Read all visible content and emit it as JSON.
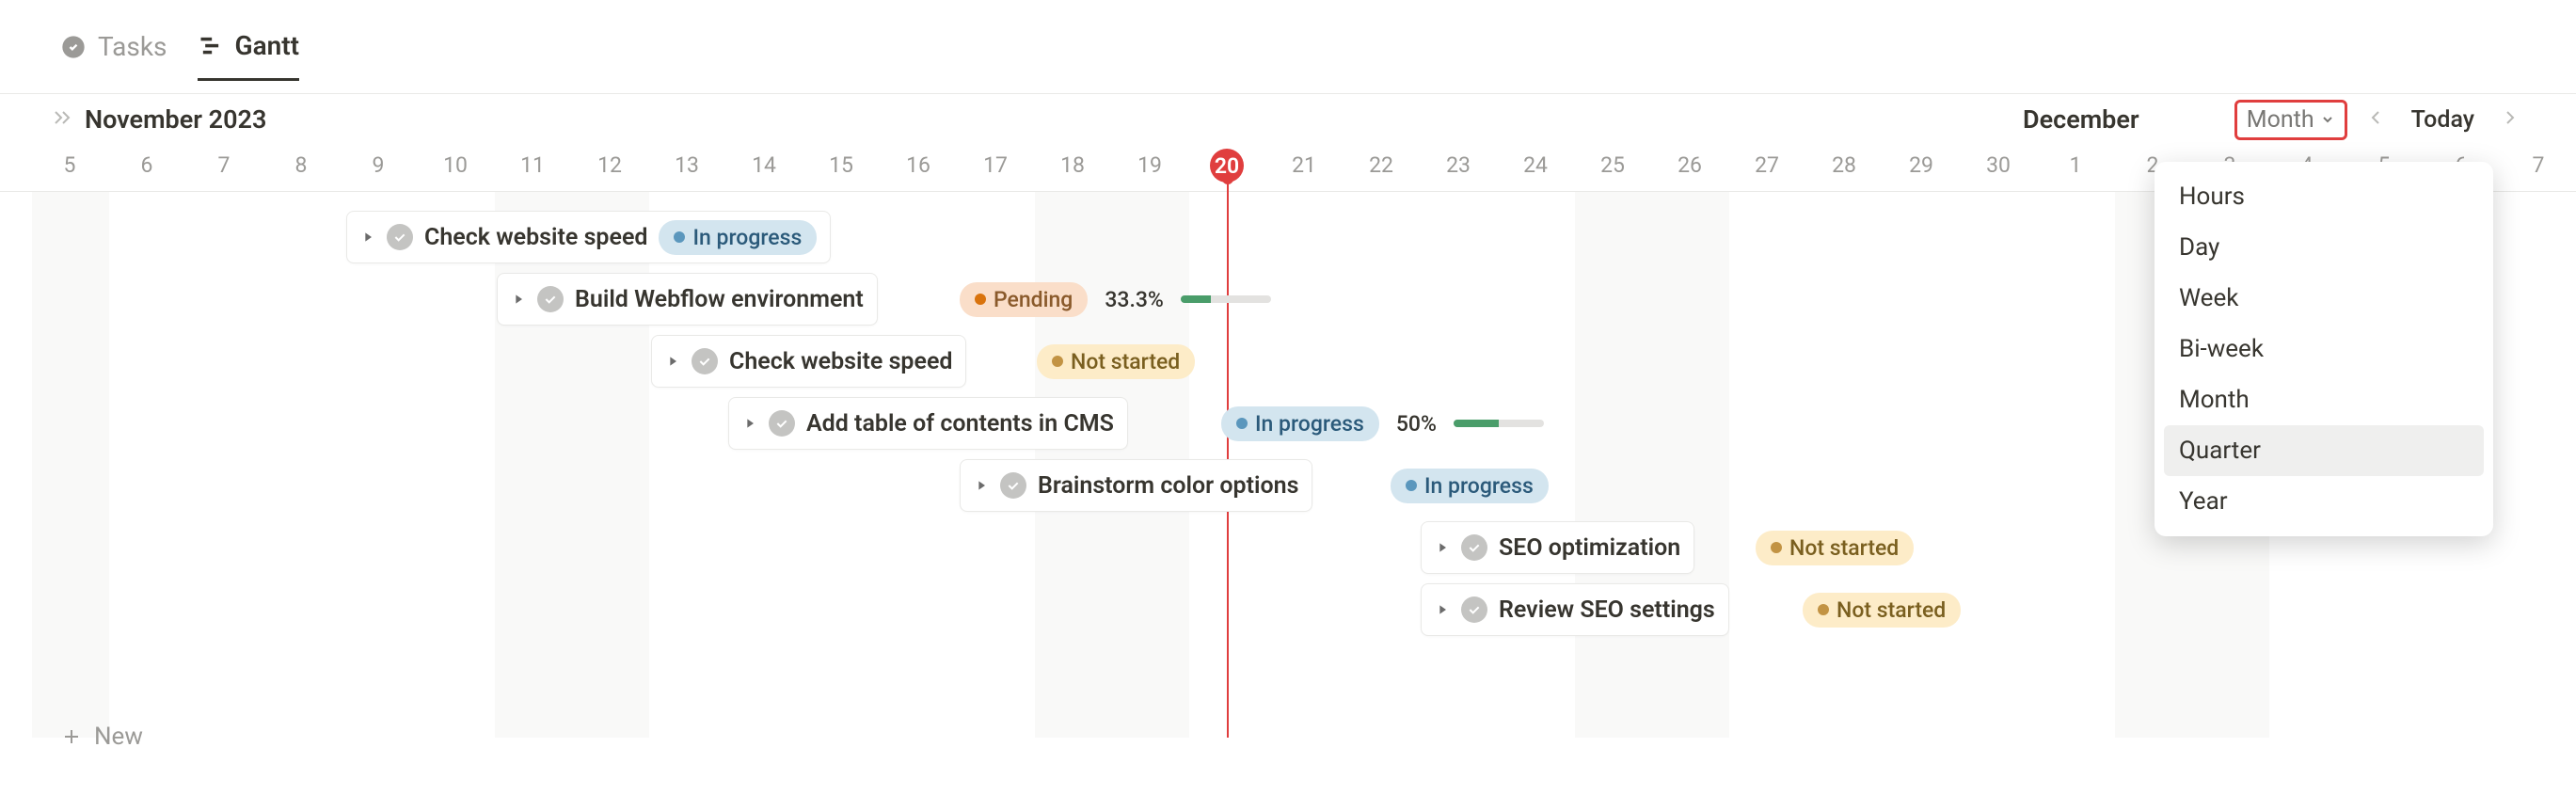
{
  "tabs": {
    "tasks_label": "Tasks",
    "gantt_label": "Gantt"
  },
  "header": {
    "month_primary": "November 2023",
    "month_secondary": "December",
    "zoom_label": "Month",
    "today_label": "Today"
  },
  "dates": [
    "5",
    "6",
    "7",
    "8",
    "9",
    "10",
    "11",
    "12",
    "13",
    "14",
    "15",
    "16",
    "17",
    "18",
    "19",
    "20",
    "21",
    "22",
    "23",
    "24",
    "25",
    "26",
    "27",
    "28",
    "29",
    "30",
    "1",
    "2",
    "3",
    "4",
    "5",
    "6",
    "7"
  ],
  "today_index": 15,
  "zoom_options": [
    "Hours",
    "Day",
    "Week",
    "Bi-week",
    "Month",
    "Quarter",
    "Year"
  ],
  "zoom_hover_index": 5,
  "tasks": [
    {
      "title": "Check website speed",
      "status_label": "In progress",
      "status_color": "blue"
    },
    {
      "title": "Build Webflow environment",
      "status_label": "Pending",
      "status_color": "orange",
      "percent": "33.3%",
      "progress": 33
    },
    {
      "title": "Check website speed",
      "status_label": "Not started",
      "status_color": "yellow"
    },
    {
      "title": "Add table of contents in CMS",
      "status_label": "In progress",
      "status_color": "blue",
      "percent": "50%",
      "progress": 50
    },
    {
      "title": "Brainstorm color options",
      "status_label": "In progress",
      "status_color": "blue"
    },
    {
      "title": "SEO optimization",
      "status_label": "Not started",
      "status_color": "yellow"
    },
    {
      "title": "Review SEO settings",
      "status_label": "Not started",
      "status_color": "yellow"
    }
  ],
  "new_label": "New"
}
